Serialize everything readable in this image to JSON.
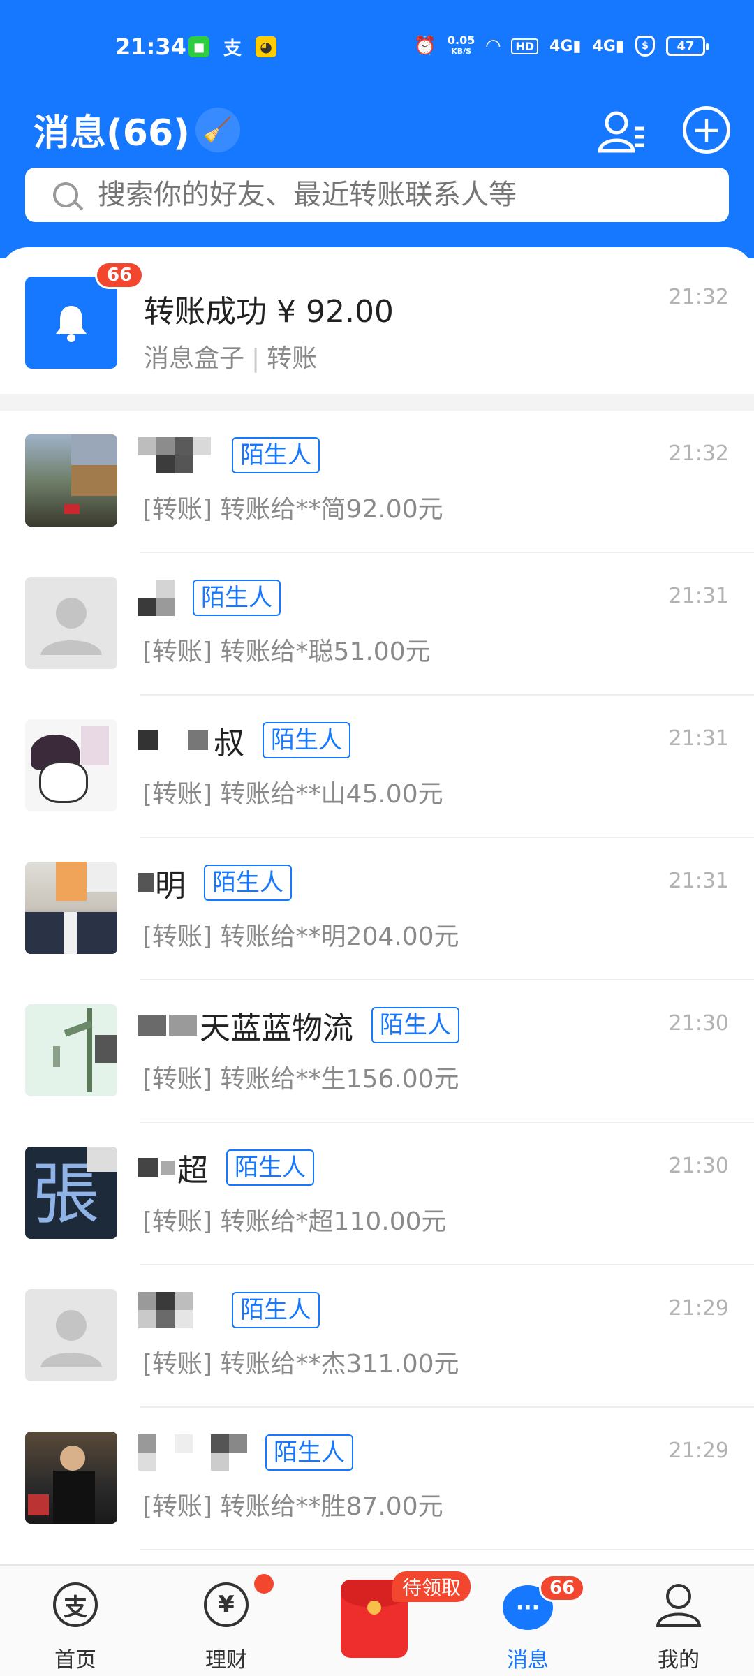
{
  "status_bar": {
    "time": "21:34",
    "net_speed_value": "0.05",
    "net_speed_unit": "KB/S",
    "signal_1": "4G",
    "signal_2": "4G",
    "hd": "HD",
    "battery": "47"
  },
  "header": {
    "title": "消息(66)"
  },
  "search": {
    "placeholder": "搜索你的好友、最近转账联系人等"
  },
  "message_box": {
    "badge": "66",
    "title": "转账成功 ¥ 92.00",
    "source": "消息盒子",
    "category": "转账",
    "time": "21:32"
  },
  "conversations": [
    {
      "name": "",
      "tag": "陌生人",
      "preview": "[转账] 转账给**简92.00元",
      "time": "21:32"
    },
    {
      "name": "",
      "tag": "陌生人",
      "preview": "[转账] 转账给*聪51.00元",
      "time": "21:31"
    },
    {
      "name": "叔",
      "tag": "陌生人",
      "preview": "[转账] 转账给**山45.00元",
      "time": "21:31"
    },
    {
      "name": "明",
      "tag": "陌生人",
      "preview": "[转账] 转账给**明204.00元",
      "time": "21:31"
    },
    {
      "name": "天蓝蓝物流",
      "tag": "陌生人",
      "preview": "[转账] 转账给**生156.00元",
      "time": "21:30"
    },
    {
      "name": "超",
      "tag": "陌生人",
      "preview": "[转账] 转账给*超110.00元",
      "time": "21:30"
    },
    {
      "name": "",
      "tag": "陌生人",
      "preview": "[转账] 转账给**杰311.00元",
      "time": "21:29"
    },
    {
      "name": "",
      "tag": "陌生人",
      "preview": "[转账] 转账给**胜87.00元",
      "time": "21:29"
    }
  ],
  "tabbar": {
    "home": "首页",
    "wealth": "理财",
    "pending": "待领取",
    "messages": "消息",
    "messages_badge": "66",
    "me": "我的"
  },
  "colors": {
    "brand": "#1677ff",
    "badge": "#f2462f"
  }
}
